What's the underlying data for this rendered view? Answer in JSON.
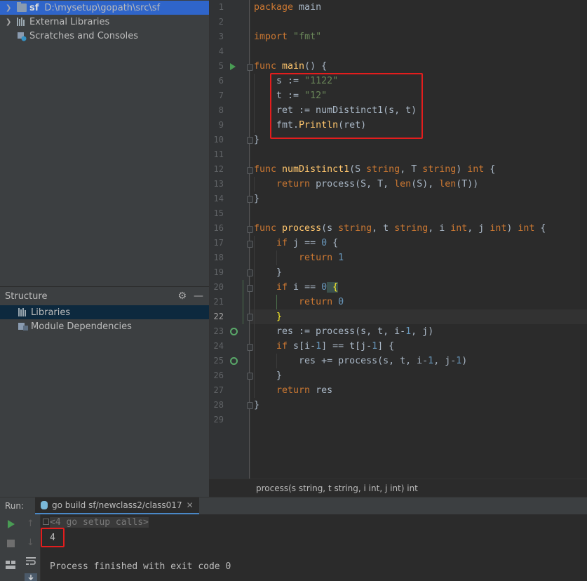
{
  "project": {
    "items": [
      {
        "name": "sf",
        "path": "D:\\mysetup\\gopath\\src\\sf"
      },
      {
        "label": "External Libraries"
      },
      {
        "label": "Scratches and Consoles"
      }
    ]
  },
  "structure": {
    "title": "Structure",
    "items": [
      {
        "label": "Libraries"
      },
      {
        "label": "Module Dependencies"
      }
    ]
  },
  "editor": {
    "line_numbers": [
      "1",
      "2",
      "3",
      "4",
      "5",
      "6",
      "7",
      "8",
      "9",
      "10",
      "11",
      "12",
      "13",
      "14",
      "15",
      "16",
      "17",
      "18",
      "19",
      "20",
      "21",
      "22",
      "23",
      "24",
      "25",
      "26",
      "27",
      "28",
      "29"
    ],
    "current_line": "22",
    "breadcrumb": "process(s string, t string, i int, j int) int",
    "code": {
      "l1_kw": "package",
      "l1_rest": " main",
      "l3_kw": "import",
      "l3_str": " \"fmt\"",
      "l5_kw": "func",
      "l5_fn": " main",
      "l5_rest": "() {",
      "l6_a": "    s := ",
      "l6_str": "\"1122\"",
      "l7_a": "    t := ",
      "l7_str": "\"12\"",
      "l8": "    ret := numDistinct1(s, t)",
      "l9_a": "    fmt.",
      "l9_fn": "Println",
      "l9_b": "(ret)",
      "l10": "}",
      "l12_kw": "func",
      "l12_fn": " numDistinct1",
      "l12_a": "(S ",
      "l12_t1": "string",
      "l12_b": ", T ",
      "l12_t2": "string",
      "l12_c": ") ",
      "l12_t3": "int",
      "l12_d": " {",
      "l13_a": "    ",
      "l13_kw": "return",
      "l13_b": " process(S, T, ",
      "l13_bi1": "len",
      "l13_c": "(S), ",
      "l13_bi2": "len",
      "l13_d": "(T))",
      "l14": "}",
      "l16_kw": "func",
      "l16_fn": " process",
      "l16_a": "(s ",
      "l16_t1": "string",
      "l16_b": ", t ",
      "l16_t2": "string",
      "l16_c": ", i ",
      "l16_t3": "int",
      "l16_d": ", j ",
      "l16_t4": "int",
      "l16_e": ") ",
      "l16_t5": "int",
      "l16_f": " {",
      "l17_a": "    ",
      "l17_kw": "if",
      "l17_b": " j == ",
      "l17_num": "0",
      "l17_c": " {",
      "l18_a": "        ",
      "l18_kw": "return",
      "l18_num": " 1",
      "l19": "    }",
      "l20_a": "    ",
      "l20_kw": "if",
      "l20_b": " i == ",
      "l20_num": "0",
      "l20_c": " {",
      "l21_a": "        ",
      "l21_kw": "return",
      "l21_num": " 0",
      "l22": "    }",
      "l23_a": "    res := process(s, t, i-",
      "l23_n1": "1",
      "l23_b": ", j)",
      "l24_a": "    ",
      "l24_kw": "if",
      "l24_b": " s[i-",
      "l24_n1": "1",
      "l24_c": "] == t[j-",
      "l24_n2": "1",
      "l24_d": "] {",
      "l25_a": "        res += process(s, t, i-",
      "l25_n1": "1",
      "l25_b": ", j-",
      "l25_n2": "1",
      "l25_c": ")",
      "l26": "    }",
      "l27_a": "    ",
      "l27_kw": "return",
      "l27_b": " res",
      "l28": "}"
    }
  },
  "run": {
    "label": "Run:",
    "tab": "go build sf/newclass2/class017",
    "console": {
      "setup": "<4 go setup calls>",
      "output": "4",
      "finish": "Process finished with exit code 0"
    }
  },
  "colors": {
    "keyword": "#cc7832",
    "string": "#6a8759",
    "number": "#6897bb",
    "function": "#ffc66d",
    "highlight_box": "#e31d1d",
    "selection": "#2f65ca"
  }
}
